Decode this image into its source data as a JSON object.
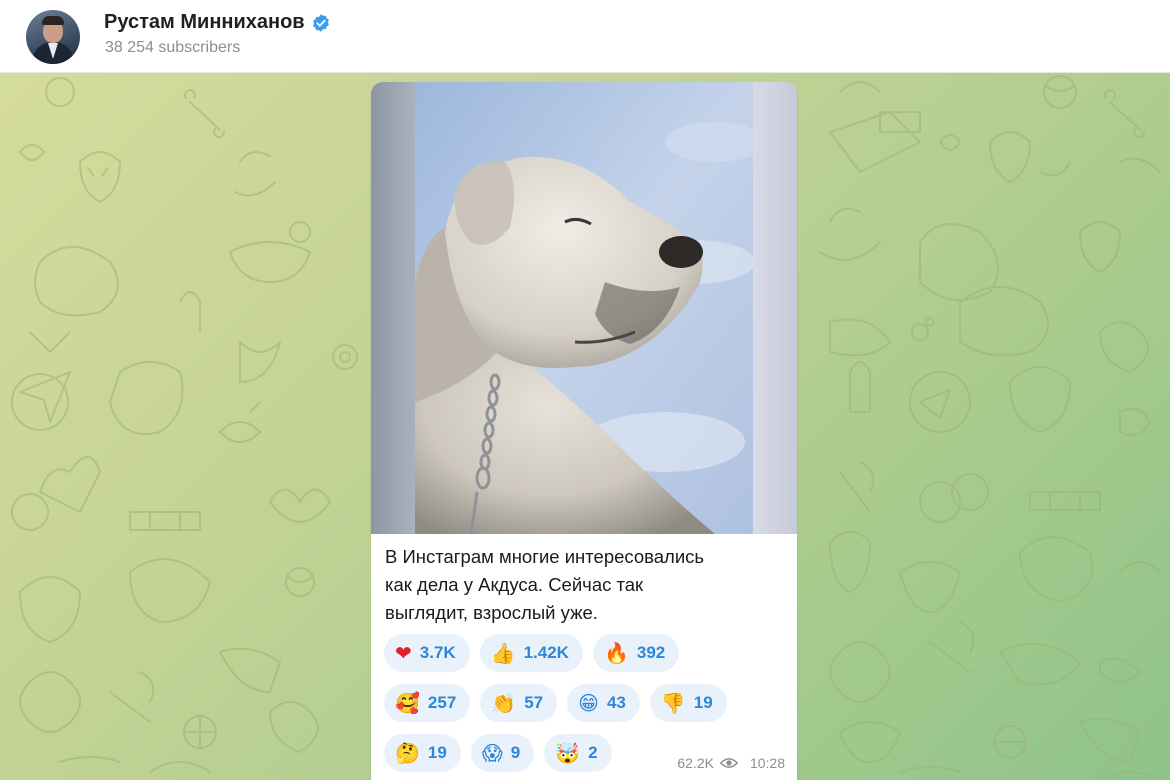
{
  "channel": {
    "name": "Рустам Минниханов",
    "subscribers": "38 254 subscribers",
    "verified": true
  },
  "post": {
    "caption_lines": [
      "В Инстаграм многие интересовались",
      "как дела у Акдуса. Сейчас так",
      "выглядит, взрослый уже."
    ],
    "reactions": [
      {
        "emoji": "❤",
        "icon": "heart-icon",
        "count": "3.7K"
      },
      {
        "emoji": "👍",
        "icon": "thumbs-up-icon",
        "count": "1.42K"
      },
      {
        "emoji": "🔥",
        "icon": "fire-icon",
        "count": "392"
      },
      {
        "emoji": "🥰",
        "icon": "smiling-face-hearts-icon",
        "count": "257"
      },
      {
        "emoji": "👏",
        "icon": "clapping-icon",
        "count": "57"
      },
      {
        "emoji": "😁",
        "icon": "grinning-icon",
        "count": "43"
      },
      {
        "emoji": "👎",
        "icon": "thumbs-down-icon",
        "count": "19"
      },
      {
        "emoji": "🤔",
        "icon": "thinking-icon",
        "count": "19"
      },
      {
        "emoji": "😱",
        "icon": "screaming-icon",
        "count": "9"
      },
      {
        "emoji": "🤯",
        "icon": "mind-blown-icon",
        "count": "2"
      }
    ],
    "views": "62.2K",
    "time": "10:28"
  },
  "colors": {
    "accent": "#2e87d6",
    "reaction_bg": "#e9f2fb",
    "verified": "#3d9bf0",
    "chat_bg_start": "#d5dc9b",
    "chat_bg_end": "#8ec38a"
  }
}
